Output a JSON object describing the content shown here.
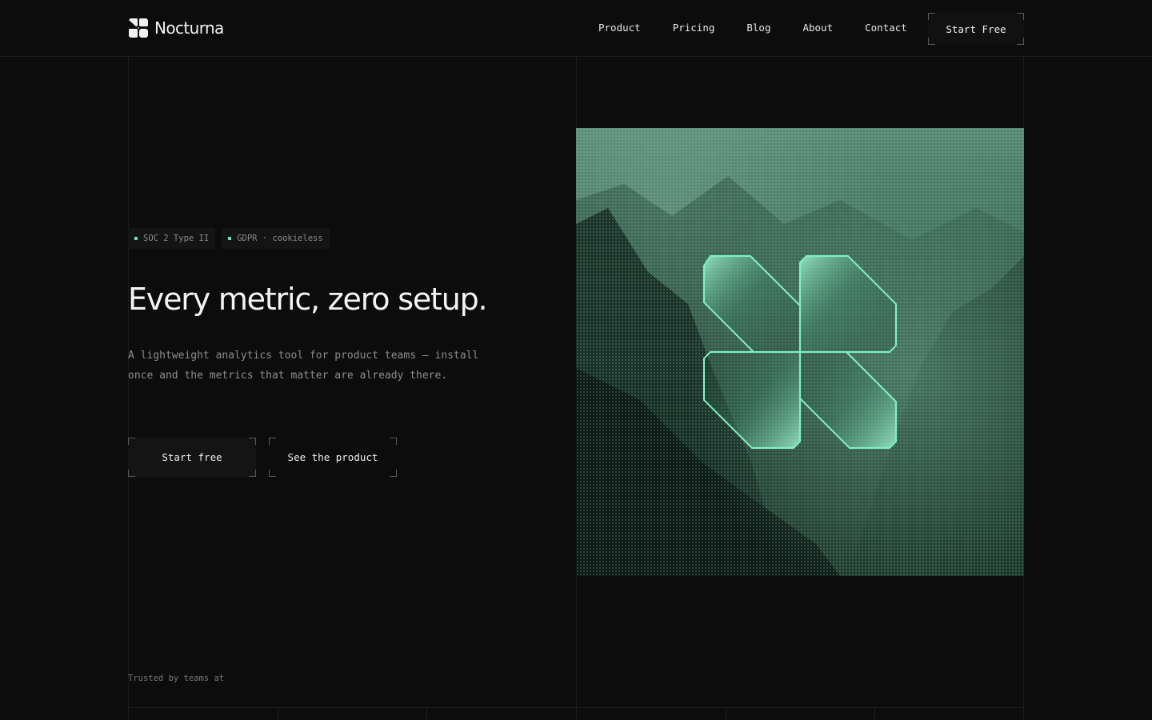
{
  "brand": {
    "name": "Nocturna"
  },
  "nav": {
    "items": [
      "Product",
      "Pricing",
      "Blog",
      "About",
      "Contact"
    ]
  },
  "header_cta": "Start Free",
  "badges": [
    "SOC 2 Type II",
    "GDPR · cookieless"
  ],
  "hero": {
    "headline": "Every metric, zero setup.",
    "subcopy": "A lightweight analytics tool for product teams — install once and the metrics that matter are already there.",
    "primary_cta": "Start free",
    "secondary_cta": "See the product"
  },
  "trusted_label": "Trusted by teams at",
  "colors": {
    "accent": "#66e3b4",
    "background": "#0c0c0c",
    "art_tint": "#5fd6a6"
  },
  "icons": {
    "logo": "nocturna-logo-icon",
    "hero": "nocturna-glass-mark-icon"
  }
}
